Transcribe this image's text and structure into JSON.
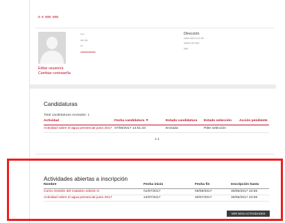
{
  "user": {
    "name": "• • ••• •••",
    "info_lines": [
      "•• •",
      "••• •••",
      "••",
      "••••••••••••"
    ],
    "address_label": "Dirección",
    "address_lines": [
      "••••• •••• •• •• •••",
      "•••••• ••• ••••",
      "••••"
    ],
    "edit_link": "Editar usuario/a",
    "password_link": "Cambiar contraseña"
  },
  "candidaturas": {
    "title": "Candidaturas",
    "total": "Total candidaturas enviadas: 1",
    "headers": [
      "Actividad",
      "Fecha candidatura",
      "Estado candidatura",
      "Estado selección",
      "Acción pendiente"
    ],
    "sort_indicator": "▼",
    "rows": [
      [
        "Actividad sobre el agua presencial junio 2017",
        "07/06/2017 14:51:33",
        "Enviada",
        "Pdte selección",
        ""
      ]
    ],
    "pagination": "1-1"
  },
  "actividades": {
    "title": "Actividades abiertas a inscripción",
    "headers": [
      "Nombre",
      "Fecha inicio",
      "Fecha fin",
      "Inscripción hasta"
    ],
    "rows": [
      [
        "Curso Gestión del Catastro edición 6",
        "01/07/2017",
        "06/08/2017",
        "30/06/2017 23:59"
      ],
      [
        "Actividad sobre el agua presencial junio 2017",
        "24/07/2017",
        "30/07/2017",
        "30/06/2017 23:59"
      ]
    ],
    "more_button": "VER MÁS ACTIVIDADES"
  },
  "colors": {
    "accent": "#c0102a",
    "highlight": "#ef1c1c",
    "button": "#3c3c3c"
  }
}
